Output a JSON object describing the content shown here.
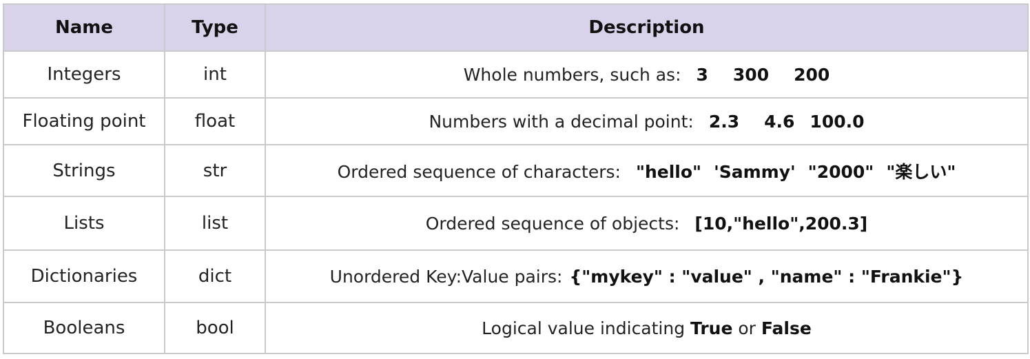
{
  "headers": {
    "name": "Name",
    "type": "Type",
    "description": "Description"
  },
  "rows": [
    {
      "name": "Integers",
      "type": "int",
      "description": "Whole numbers, such as:",
      "examples": [
        "3",
        "300",
        "200"
      ]
    },
    {
      "name": "Floating point",
      "type": "float",
      "description": "Numbers with a decimal point:",
      "examples": [
        "2.3",
        "4.6",
        "100.0"
      ]
    },
    {
      "name": "Strings",
      "type": "str",
      "description": "Ordered sequence of characters:",
      "examples": [
        "\"hello\"",
        "'Sammy'",
        "\"2000\"",
        "\"楽しい\""
      ]
    },
    {
      "name": "Lists",
      "type": "list",
      "description": "Ordered sequence of objects:",
      "examples": [
        "[10,\"hello\",200.3]"
      ]
    },
    {
      "name": "Dictionaries",
      "type": "dict",
      "description": "Unordered Key:Value pairs:",
      "examples": [
        "{\"mykey\" : \"value\" , \"name\" : \"Frankie\"}"
      ]
    },
    {
      "name": "Booleans",
      "type": "bool",
      "description_prefix": "Logical value indicating",
      "true_word": "True",
      "or_word": "or",
      "false_word": "False"
    }
  ],
  "colors": {
    "header_background": "#d9d2ea",
    "border": "#c9c9c9"
  }
}
